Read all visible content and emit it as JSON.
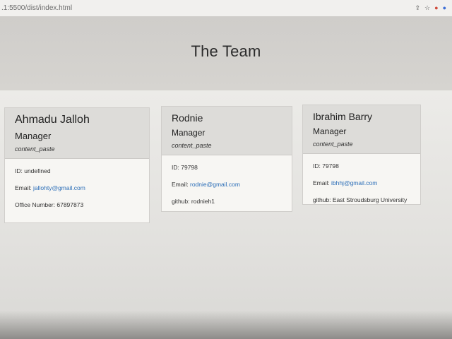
{
  "browser": {
    "url": ".1:5500/dist/index.html"
  },
  "header": {
    "title": "The Team"
  },
  "team": [
    {
      "name": "Ahmadu Jalloh",
      "role": "Manager",
      "icon_text": "content_paste",
      "id_text": "ID: undefined",
      "email_label": "Email: ",
      "email": "jallohty@gmail.com",
      "extra": "Office Number: 67897873"
    },
    {
      "name": "Rodnie",
      "role": "Manager",
      "icon_text": "content_paste",
      "id_text": "ID: 79798",
      "email_label": "Email: ",
      "email": "rodnie@gmail.com",
      "extra": "github: rodnieh1"
    },
    {
      "name": "Ibrahim Barry",
      "role": "Manager",
      "icon_text": "content_paste",
      "id_text": "ID: 79798",
      "email_label": "Email: ",
      "email": "ibhhj@gmail.com",
      "extra": "github: East Stroudsburg University"
    }
  ]
}
